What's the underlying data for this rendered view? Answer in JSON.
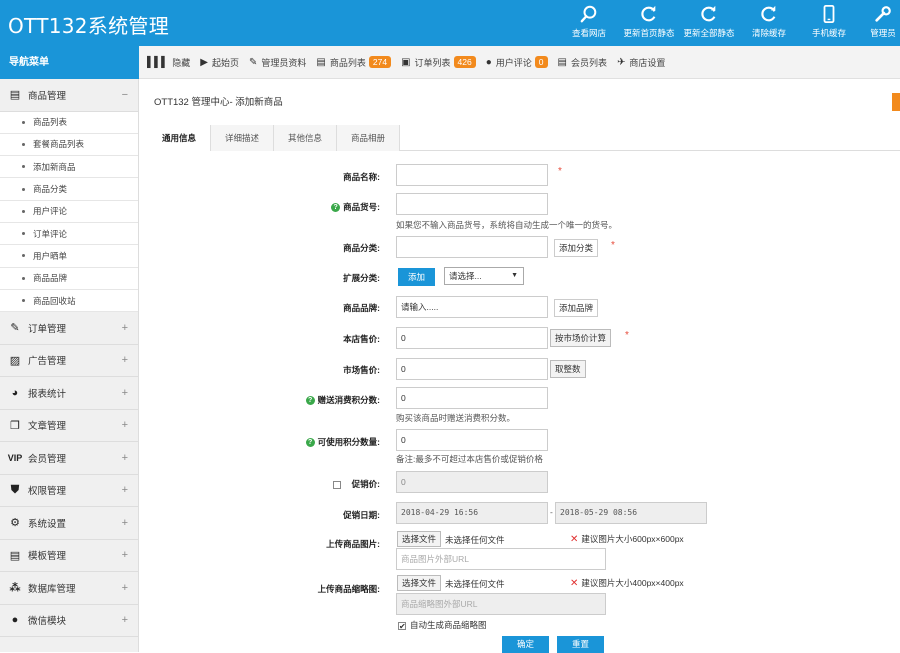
{
  "app": {
    "title": "OTT132系统管理"
  },
  "header_nav": [
    {
      "label": "查看网店",
      "icon": "search-icon"
    },
    {
      "label": "更新首页静态",
      "icon": "refresh-icon"
    },
    {
      "label": "更新全部静态",
      "icon": "refresh-icon"
    },
    {
      "label": "清除缓存",
      "icon": "refresh-icon"
    },
    {
      "label": "手机缓存",
      "icon": "mobile-icon"
    },
    {
      "label": "管理员",
      "icon": "wrench-icon"
    }
  ],
  "sidebar": {
    "title": "导航菜单",
    "sections": [
      {
        "label": "商品管理",
        "icon": "document-icon",
        "toggle": "−",
        "expanded": true,
        "items": [
          "商品列表",
          "套餐商品列表",
          "添加新商品",
          "商品分类",
          "用户评论",
          "订单评论",
          "用户晒单",
          "商品品牌",
          "商品回收站"
        ]
      },
      {
        "label": "订单管理",
        "icon": "edit-icon",
        "toggle": "+"
      },
      {
        "label": "广告管理",
        "icon": "image-icon",
        "toggle": "+"
      },
      {
        "label": "报表统计",
        "icon": "pie-chart-icon",
        "toggle": "+"
      },
      {
        "label": "文章管理",
        "icon": "copy-icon",
        "toggle": "+"
      },
      {
        "label": "会员管理",
        "icon": "vip-icon",
        "toggle": "+"
      },
      {
        "label": "权限管理",
        "icon": "shield-icon",
        "toggle": "+"
      },
      {
        "label": "系统设置",
        "icon": "gear-icon",
        "toggle": "+"
      },
      {
        "label": "模板管理",
        "icon": "template-icon",
        "toggle": "+"
      },
      {
        "label": "数据库管理",
        "icon": "network-icon",
        "toggle": "+"
      },
      {
        "label": "微信模块",
        "icon": "chat-icon",
        "toggle": "+"
      }
    ]
  },
  "toolbar": {
    "items": [
      {
        "label": "隐藏",
        "icon": "bars-icon"
      },
      {
        "label": "起始页",
        "icon": "play-icon"
      },
      {
        "label": "管理员资料",
        "icon": "edit-icon"
      },
      {
        "label": "商品列表",
        "icon": "document-icon",
        "badge": "274"
      },
      {
        "label": "订单列表",
        "icon": "clipboard-icon",
        "badge": "426"
      },
      {
        "label": "用户评论",
        "icon": "chat-icon",
        "badge": "0"
      },
      {
        "label": "会员列表",
        "icon": "document-icon"
      },
      {
        "label": "商店设置",
        "icon": "pin-icon"
      }
    ]
  },
  "main": {
    "breadcrumb": "OTT132 管理中心- 添加新商品",
    "tabs": [
      "通用信息",
      "详细描述",
      "其他信息",
      "商品相册"
    ],
    "active_tab": 0,
    "form": {
      "name_label": "商品名称:",
      "sn_label": "商品货号:",
      "sn_hint": "如果您不输入商品货号，系统将自动生成一个唯一的货号。",
      "cat_label": "商品分类:",
      "cat_add": "添加分类",
      "ext_label": "扩展分类:",
      "ext_add": "添加",
      "ext_select": "请选择...",
      "brand_label": "商品品牌:",
      "brand_placeholder": "请输入.....",
      "brand_add": "添加品牌",
      "shop_price_label": "本店售价:",
      "shop_price_value": "0",
      "shop_price_btn": "按市场价计算",
      "market_price_label": "市场售价:",
      "market_price_value": "0",
      "market_price_btn": "取整数",
      "give_points_label": "赠送消费积分数:",
      "give_points_value": "0",
      "give_points_hint": "购买该商品时赠送消费积分数。",
      "use_points_label": "可使用积分数量:",
      "use_points_value": "0",
      "use_points_hint": "备注:最多不可超过本店售价或促销价格",
      "promo_label": "促销价:",
      "promo_value": "0",
      "promo_date_label": "促销日期:",
      "promo_start": "2018-04-29 16:56",
      "promo_sep": "-",
      "promo_end": "2018-05-29 08:56",
      "img_label": "上传商品图片:",
      "img_choose": "选择文件",
      "img_nofile": "未选择任何文件",
      "img_advice": "建议图片大小600px×600px",
      "img_url_placeholder": "商品图片外部URL",
      "thumb_label": "上传商品缩略图:",
      "thumb_choose": "选择文件",
      "thumb_nofile": "未选择任何文件",
      "thumb_advice": "建议图片大小400px×400px",
      "thumb_url_placeholder": "商品缩略图外部URL",
      "auto_thumb_label": "自动生成商品缩略图",
      "auto_thumb_checked": true,
      "required_mark": "*",
      "confirm_btn": "确定",
      "reset_btn": "重置"
    }
  }
}
